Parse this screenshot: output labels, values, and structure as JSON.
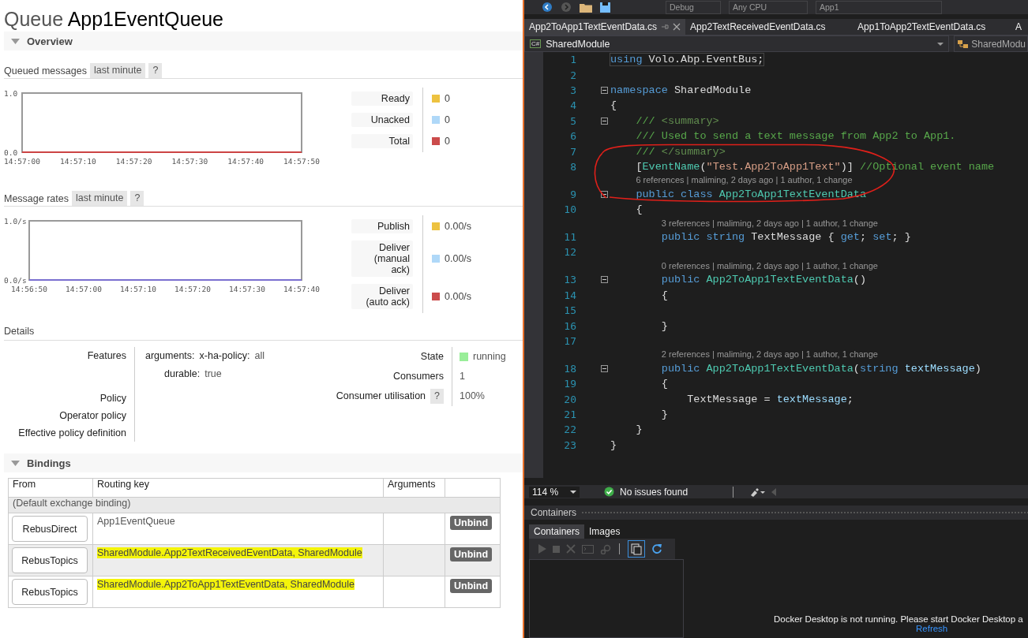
{
  "queue": {
    "prefix": "Queue",
    "name": "App1EventQueue"
  },
  "overview": {
    "title": "Overview",
    "expanded": true
  },
  "queued_messages": {
    "title": "Queued messages",
    "range": "last minute",
    "help": "?",
    "chart_data": {
      "type": "line",
      "categories": [
        "14:57:00",
        "14:57:10",
        "14:57:20",
        "14:57:30",
        "14:57:40",
        "14:57:50"
      ],
      "ylim": [
        0,
        1
      ],
      "yticks": [
        {
          "value": 0,
          "label": "0.0"
        },
        {
          "value": 1,
          "label": "1.0"
        }
      ],
      "series": [
        {
          "color": "#cc4444",
          "values": [
            0,
            0,
            0,
            0,
            0,
            0
          ]
        }
      ]
    },
    "legend": [
      {
        "label": "Ready",
        "color": "#edc240",
        "value": "0"
      },
      {
        "label": "Unacked",
        "color": "#afd8f8",
        "value": "0"
      },
      {
        "label": "Total",
        "color": "#cb4b4b",
        "value": "0"
      }
    ]
  },
  "message_rates": {
    "title": "Message rates",
    "range": "last minute",
    "help": "?",
    "chart_data": {
      "type": "line",
      "categories": [
        "14:56:50",
        "14:57:00",
        "14:57:10",
        "14:57:20",
        "14:57:30",
        "14:57:40"
      ],
      "ylim": [
        0,
        1
      ],
      "yticks": [
        {
          "value": 0,
          "label": "0.0/s"
        },
        {
          "value": 1,
          "label": "1.0/s"
        }
      ],
      "series": [
        {
          "color": "#7a6fd0",
          "values": [
            0,
            0,
            0,
            0,
            0,
            0
          ]
        }
      ]
    },
    "legend": [
      {
        "label": "Publish",
        "color": "#edc240",
        "value": "0.00/s"
      },
      {
        "label": "Deliver (manual ack)",
        "color": "#afd8f8",
        "value": "0.00/s"
      },
      {
        "label": "Deliver (auto ack)",
        "color": "#cb4b4b",
        "value": "0.00/s"
      }
    ]
  },
  "details": {
    "title": "Details",
    "features_label": "Features",
    "features": [
      {
        "key": "arguments:",
        "subkey": "x-ha-policy:",
        "value": "all"
      },
      {
        "key": "durable:",
        "value": "true"
      }
    ],
    "policies": [
      "Policy",
      "Operator policy",
      "Effective policy definition"
    ],
    "stats": [
      {
        "label": "State",
        "value": "running",
        "kind": "status",
        "color": "#99ee99"
      },
      {
        "label": "Consumers",
        "value": "1",
        "kind": "plain"
      },
      {
        "label": "Consumer utilisation",
        "help": "?",
        "value": "100%",
        "kind": "plain"
      }
    ]
  },
  "bindings": {
    "title": "Bindings",
    "expanded": true,
    "columns": [
      "From",
      "Routing key",
      "Arguments"
    ],
    "group": "(Default exchange binding)",
    "rows": [
      {
        "from": "RebusDirect",
        "routing_key": "App1EventQueue",
        "highlighted": false,
        "selected": false,
        "action": "Unbind"
      },
      {
        "from": "RebusTopics",
        "routing_key": "SharedModule.App2TextReceivedEventData, SharedModule",
        "highlighted": true,
        "selected": true,
        "action": "Unbind"
      },
      {
        "from": "RebusTopics",
        "routing_key": "SharedModule.App2ToApp1TextEventData, SharedModule",
        "highlighted": true,
        "selected": false,
        "action": "Unbind"
      }
    ]
  },
  "ide": {
    "toolbar": {
      "dropdowns": [
        "Debug",
        "Any CPU",
        "App1"
      ]
    },
    "tabs": [
      {
        "label": "App2ToApp1TextEventData.cs",
        "selected": true
      },
      {
        "label": "App2TextReceivedEventData.cs",
        "selected": false
      },
      {
        "label": "App1ToApp2TextEventData.cs",
        "selected": false
      },
      {
        "label": "A",
        "selected": false
      }
    ],
    "nav": {
      "icon_text": "C#",
      "project": "SharedModule",
      "member": "SharedModu"
    },
    "lines": [
      {
        "number": "1",
        "fold": false,
        "tokens": [
          {
            "kind": "keyword",
            "text": "using"
          },
          {
            "kind": "plain",
            "text": " Volo.Abp.EventBus;"
          }
        ]
      },
      {
        "number": "2",
        "fold": false
      },
      {
        "number": "3",
        "fold": true,
        "tokens": [
          {
            "kind": "keyword",
            "text": "namespace"
          },
          {
            "kind": "plain",
            "text": " SharedModule"
          }
        ]
      },
      {
        "number": "4",
        "fold": false,
        "tokens": [
          {
            "kind": "plain",
            "text": "{"
          }
        ]
      },
      {
        "number": "5",
        "fold": true,
        "tokens": [
          {
            "kind": "comment",
            "text": "    /// "
          },
          {
            "kind": "doc",
            "text": "<summary>"
          }
        ]
      },
      {
        "number": "6",
        "fold": false,
        "tokens": [
          {
            "kind": "comment",
            "text": "    /// Used to send a text message from App2 to App1."
          }
        ]
      },
      {
        "number": "7",
        "fold": false,
        "tokens": [
          {
            "kind": "comment",
            "text": "    /// "
          },
          {
            "kind": "doc",
            "text": "</summary>"
          }
        ]
      },
      {
        "number": "8",
        "fold": false,
        "tokens": [
          {
            "kind": "plain",
            "text": "    ["
          },
          {
            "kind": "type",
            "text": "EventName"
          },
          {
            "kind": "plain",
            "text": "("
          },
          {
            "kind": "string",
            "text": "\"Test.App2ToApp1Text\""
          },
          {
            "kind": "plain",
            "text": ")] "
          },
          {
            "kind": "comment",
            "text": "//Optional event name"
          }
        ]
      },
      {
        "number": "9",
        "fold": true,
        "lens": "6 references | maliming, 2 days ago | 1 author, 1 change",
        "tokens": [
          {
            "kind": "keyword",
            "text": "    public class"
          },
          {
            "kind": "type",
            "text": " App2ToApp1TextEventData"
          }
        ]
      },
      {
        "number": "10",
        "fold": false,
        "tokens": [
          {
            "kind": "plain",
            "text": "    {"
          }
        ]
      },
      {
        "number": "11",
        "fold": false,
        "lens": "3 references | maliming, 2 days ago | 1 author, 1 change",
        "tokens": [
          {
            "kind": "keyword",
            "text": "        public string"
          },
          {
            "kind": "plain",
            "text": " TextMessage { "
          },
          {
            "kind": "keyword",
            "text": "get"
          },
          {
            "kind": "plain",
            "text": "; "
          },
          {
            "kind": "keyword",
            "text": "set"
          },
          {
            "kind": "plain",
            "text": "; }"
          }
        ]
      },
      {
        "number": "12",
        "fold": false
      },
      {
        "number": "13",
        "fold": true,
        "lens": "0 references | maliming, 2 days ago | 1 author, 1 change",
        "tokens": [
          {
            "kind": "keyword",
            "text": "        public"
          },
          {
            "kind": "type",
            "text": " App2ToApp1TextEventData"
          },
          {
            "kind": "plain",
            "text": "()"
          }
        ]
      },
      {
        "number": "14",
        "fold": false,
        "tokens": [
          {
            "kind": "plain",
            "text": "        {"
          }
        ]
      },
      {
        "number": "15",
        "fold": false
      },
      {
        "number": "16",
        "fold": false,
        "tokens": [
          {
            "kind": "plain",
            "text": "        }"
          }
        ]
      },
      {
        "number": "17",
        "fold": false
      },
      {
        "number": "18",
        "fold": true,
        "lens": "2 references | maliming, 2 days ago | 1 author, 1 change",
        "tokens": [
          {
            "kind": "keyword",
            "text": "        public"
          },
          {
            "kind": "type",
            "text": " App2ToApp1TextEventData"
          },
          {
            "kind": "plain",
            "text": "("
          },
          {
            "kind": "keyword",
            "text": "string"
          },
          {
            "kind": "param",
            "text": " textMessage"
          },
          {
            "kind": "plain",
            "text": ")"
          }
        ]
      },
      {
        "number": "19",
        "fold": false,
        "tokens": [
          {
            "kind": "plain",
            "text": "        {"
          }
        ]
      },
      {
        "number": "20",
        "fold": false,
        "tokens": [
          {
            "kind": "plain",
            "text": "            TextMessage = "
          },
          {
            "kind": "param",
            "text": "textMessage"
          },
          {
            "kind": "plain",
            "text": ";"
          }
        ]
      },
      {
        "number": "21",
        "fold": false,
        "tokens": [
          {
            "kind": "plain",
            "text": "        }"
          }
        ]
      },
      {
        "number": "22",
        "fold": false,
        "tokens": [
          {
            "kind": "plain",
            "text": "    }"
          }
        ]
      },
      {
        "number": "23",
        "fold": false,
        "tokens": [
          {
            "kind": "plain",
            "text": "}"
          }
        ]
      }
    ],
    "status": {
      "zoom": "114 %",
      "issues": "No issues found"
    },
    "containers": {
      "title": "Containers",
      "tabs": [
        {
          "label": "Containers",
          "selected": true
        },
        {
          "label": "Images",
          "selected": false
        }
      ],
      "message": "Docker Desktop is not running. Please start Docker Desktop a",
      "link": "Refresh"
    }
  }
}
